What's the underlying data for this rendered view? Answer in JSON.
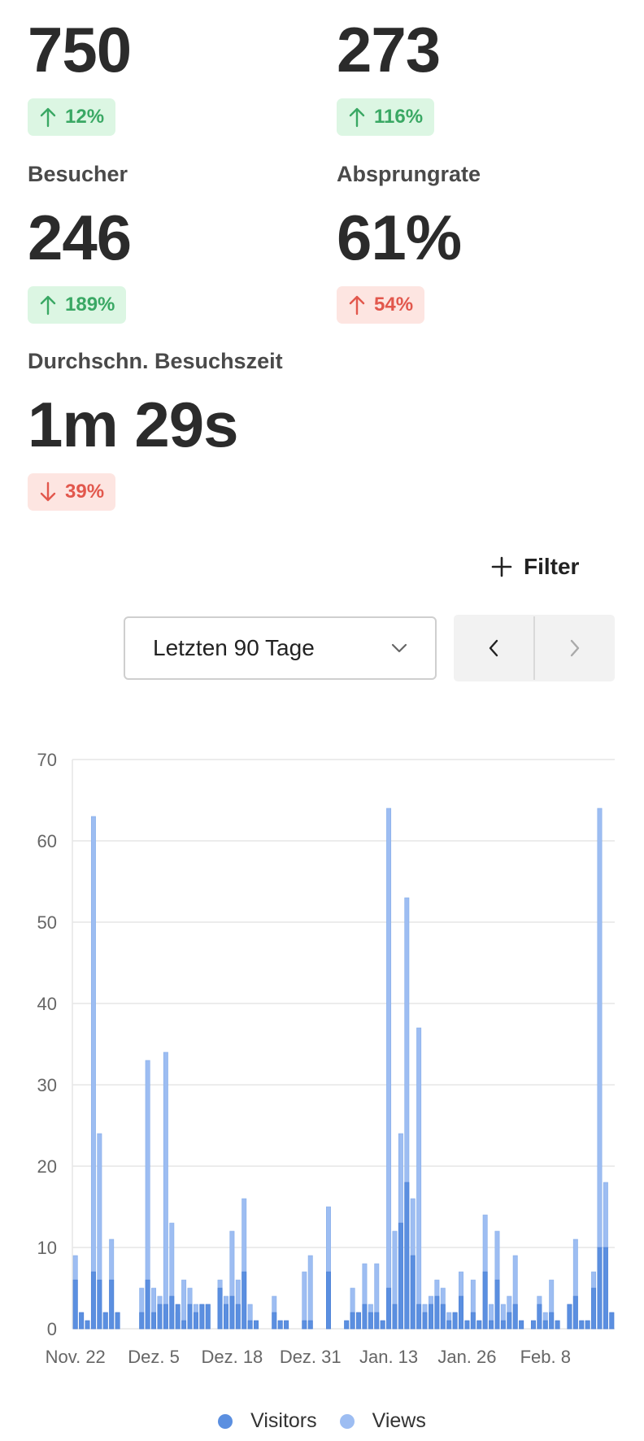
{
  "metrics": [
    {
      "id": "views",
      "label": "",
      "value": "750",
      "change": "12%",
      "direction": "up",
      "sentiment": "good"
    },
    {
      "id": "visits",
      "label": "",
      "value": "273",
      "change": "116%",
      "direction": "up",
      "sentiment": "good"
    },
    {
      "id": "visitors",
      "label": "Besucher",
      "value": "246",
      "change": "189%",
      "direction": "up",
      "sentiment": "good"
    },
    {
      "id": "bounce",
      "label": "Absprungrate",
      "value": "61%",
      "change": "54%",
      "direction": "up",
      "sentiment": "bad"
    },
    {
      "id": "duration",
      "label": "Durchschn. Besuchszeit",
      "value": "1m 29s",
      "change": "39%",
      "direction": "down",
      "sentiment": "bad"
    }
  ],
  "toolbar": {
    "filter_label": "Filter",
    "range_value": "Letzten 90 Tage",
    "prev_icon": "chevron-left-icon",
    "next_icon": "chevron-right-icon"
  },
  "colors": {
    "good_bg": "#dcf6e3",
    "good_fg": "#3aa864",
    "bad_bg": "#fde5e1",
    "bad_fg": "#e2574c",
    "visitors": "#5b8fe0",
    "views": "#9dbdf2"
  },
  "chart_data": {
    "type": "bar",
    "stacked": "overlaid",
    "ylim": [
      0,
      70
    ],
    "yticks": [
      0,
      10,
      20,
      30,
      40,
      50,
      60,
      70
    ],
    "xtick_labels": [
      "Nov. 22",
      "Dez. 5",
      "Dez. 18",
      "Dez. 31",
      "Jan. 13",
      "Jan. 26",
      "Feb. 8"
    ],
    "xtick_days": [
      1,
      14,
      27,
      40,
      53,
      66,
      79
    ],
    "grid": true,
    "legend": "bottom-center",
    "series": [
      {
        "name": "Visitors",
        "values": [
          6,
          2,
          1,
          7,
          6,
          2,
          6,
          2,
          0,
          0,
          0,
          2,
          6,
          2,
          3,
          3,
          4,
          3,
          1,
          3,
          2,
          3,
          3,
          0,
          5,
          3,
          4,
          3,
          7,
          1,
          1,
          0,
          0,
          2,
          1,
          1,
          0,
          0,
          1,
          1,
          0,
          0,
          7,
          0,
          0,
          1,
          2,
          2,
          3,
          2,
          2,
          1,
          5,
          3,
          13,
          18,
          9,
          3,
          2,
          3,
          4,
          3,
          1,
          2,
          4,
          1,
          2,
          1,
          7,
          1,
          6,
          1,
          2,
          3,
          1,
          0,
          1,
          3,
          1,
          2,
          1,
          0,
          3,
          4,
          1,
          1,
          5,
          10,
          10,
          2
        ]
      },
      {
        "name": "Views",
        "values": [
          9,
          2,
          1,
          63,
          24,
          2,
          11,
          2,
          0,
          0,
          0,
          5,
          33,
          5,
          4,
          34,
          13,
          2,
          6,
          5,
          3,
          3,
          3,
          0,
          6,
          4,
          12,
          6,
          16,
          3,
          1,
          0,
          0,
          4,
          1,
          1,
          0,
          0,
          7,
          9,
          0,
          0,
          15,
          0,
          0,
          1,
          5,
          2,
          8,
          3,
          8,
          1,
          64,
          12,
          24,
          53,
          16,
          37,
          3,
          4,
          6,
          5,
          2,
          2,
          7,
          1,
          6,
          1,
          14,
          3,
          12,
          3,
          4,
          9,
          1,
          0,
          1,
          4,
          2,
          6,
          1,
          0,
          3,
          11,
          1,
          1,
          7,
          64,
          18,
          2
        ]
      }
    ]
  }
}
